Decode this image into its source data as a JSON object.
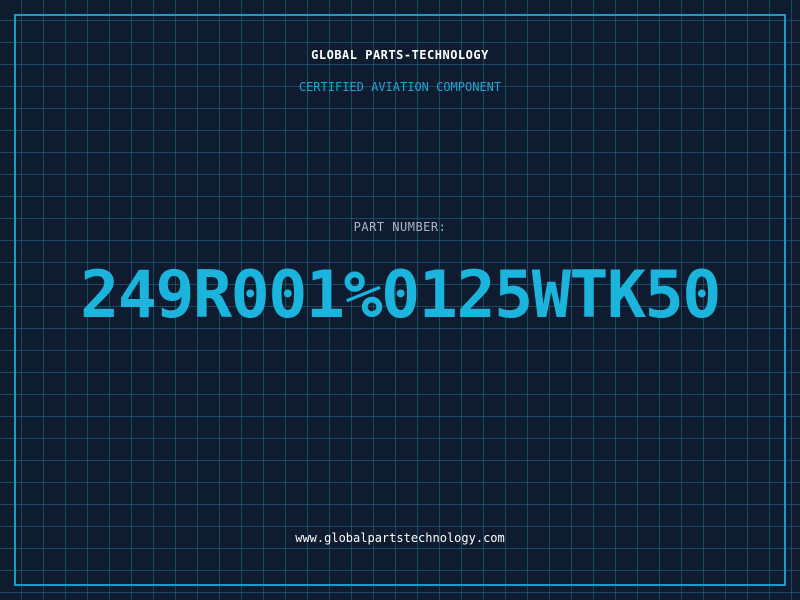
{
  "header": {
    "company": "GLOBAL PARTS-TECHNOLOGY",
    "subtitle": "CERTIFIED AVIATION COMPONENT"
  },
  "part": {
    "label": "PART NUMBER:",
    "number": "249R001%0125WTK50"
  },
  "footer": {
    "website": "www.globalpartstechnology.com"
  },
  "colors": {
    "background": "#0f1b2e",
    "grid": "#216e8c",
    "accent": "#1ab4dd",
    "frame": "#1b9cc6"
  }
}
